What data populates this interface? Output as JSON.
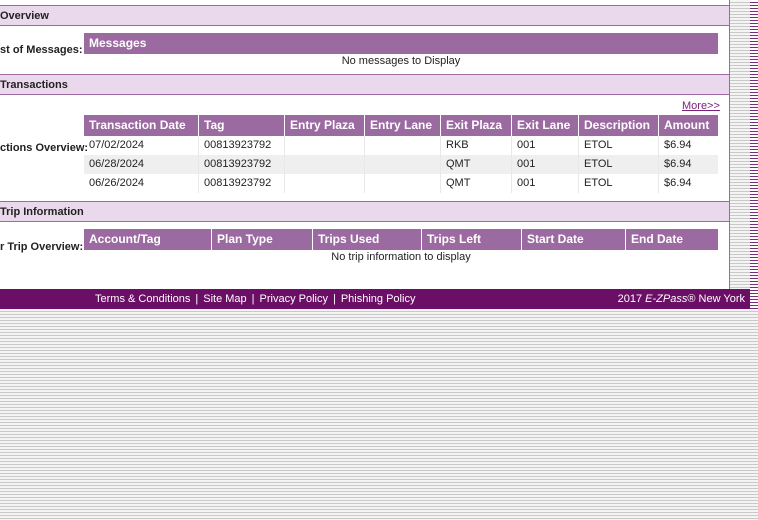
{
  "sections": {
    "overview": {
      "title": "Overview"
    },
    "messages": {
      "label": "st of Messages:",
      "header": "Messages",
      "empty": "No messages to Display"
    },
    "transactions": {
      "title": "Transactions",
      "label": "ctions Overview:",
      "more": "More>>",
      "columns": [
        "Transaction Date",
        "Tag",
        "Entry Plaza",
        "Entry Lane",
        "Exit Plaza",
        "Exit Lane",
        "Description",
        "Amount"
      ],
      "rows": [
        [
          "07/02/2024",
          "00813923792",
          "",
          "",
          "RKB",
          "001",
          "ETOL",
          "$6.94"
        ],
        [
          "06/28/2024",
          "00813923792",
          "",
          "",
          "QMT",
          "001",
          "ETOL",
          "$6.94"
        ],
        [
          "06/26/2024",
          "00813923792",
          "",
          "",
          "QMT",
          "001",
          "ETOL",
          "$6.94"
        ]
      ]
    },
    "trips": {
      "title": "Trip Information",
      "label": "r Trip Overview:",
      "columns": [
        "Account/Tag",
        "Plan Type",
        "Trips Used",
        "Trips Left",
        "Start Date",
        "End Date"
      ],
      "empty": "No trip information to display"
    }
  },
  "footer": {
    "links": [
      "Terms & Conditions",
      "Site Map",
      "Privacy Policy",
      "Phishing Policy"
    ],
    "separator": "|",
    "copyright_year": "2017",
    "copyright_brand": "E-ZPass",
    "copyright_suffix": "® New York"
  },
  "colors": {
    "header_purple": "#9b6aa0",
    "section_lavender": "#ead9ec",
    "footer_purple": "#6b0f66",
    "link_purple": "#7a1f7a"
  }
}
